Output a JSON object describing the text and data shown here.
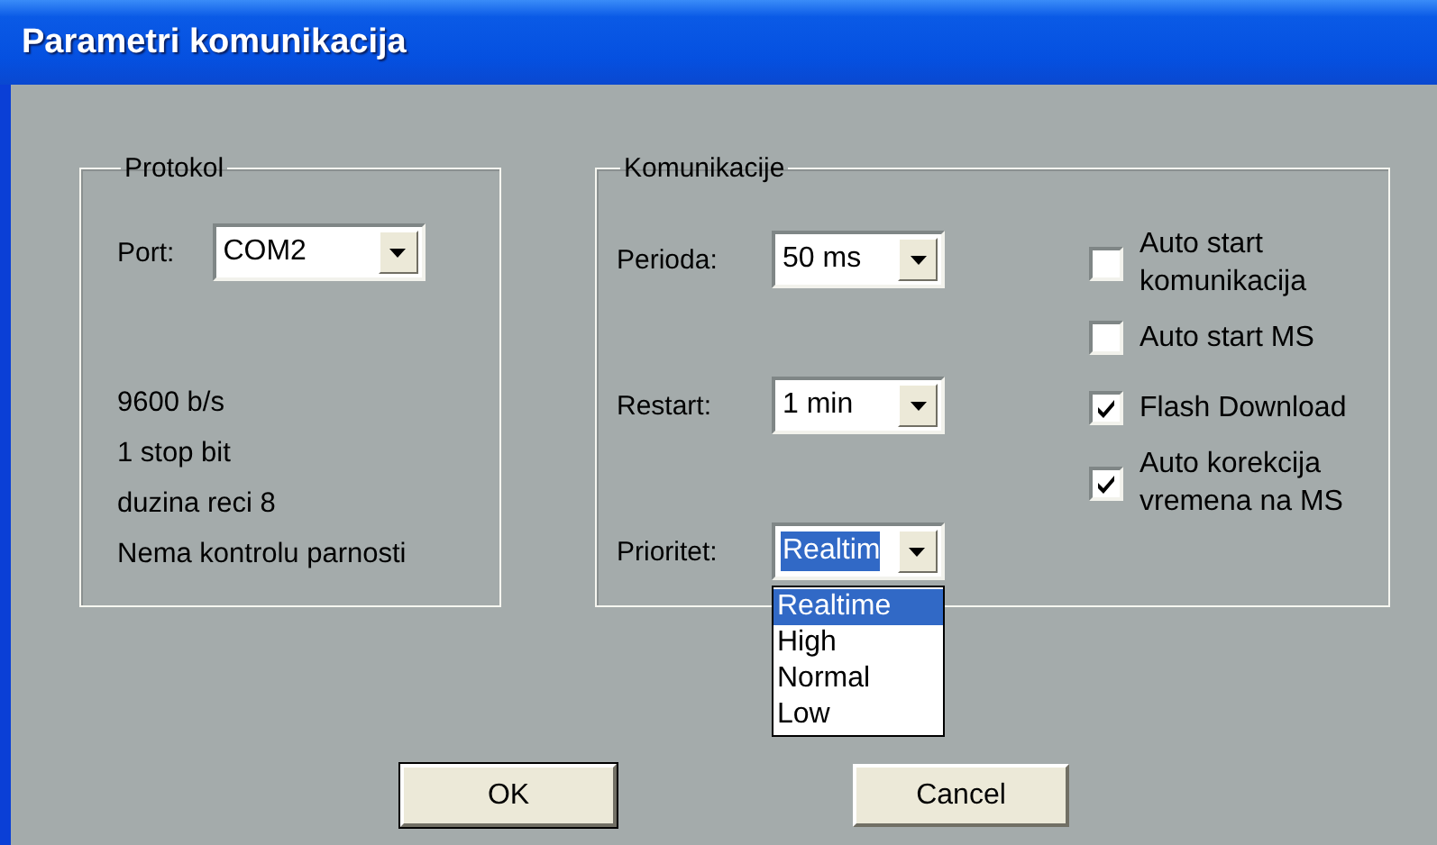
{
  "window": {
    "title": "Parametri komunikacija"
  },
  "protokol": {
    "title": "Protokol",
    "port": {
      "label": "Port:",
      "value": "COM2"
    },
    "info": [
      "9600 b/s",
      "1 stop bit",
      "duzina reci 8",
      "Nema kontrolu parnosti"
    ]
  },
  "komunikacije": {
    "title": "Komunikacije",
    "fields": [
      {
        "label": "Perioda:",
        "value": "50 ms",
        "focused": false
      },
      {
        "label": "Restart:",
        "value": "1 min",
        "focused": false
      },
      {
        "label": "Prioritet:",
        "value": "Realtim",
        "focused": true,
        "expanded": true,
        "options": [
          {
            "label": "Realtime",
            "selected": true
          },
          {
            "label": "High",
            "selected": false
          },
          {
            "label": "Normal",
            "selected": false
          },
          {
            "label": "Low",
            "selected": false
          }
        ]
      }
    ],
    "checkboxes": [
      {
        "label": "Auto start komunikacija",
        "checked": false
      },
      {
        "label": "Auto start MS",
        "checked": false
      },
      {
        "label": "Flash Download",
        "checked": true
      },
      {
        "label": "Auto korekcija vremena na MS",
        "checked": true
      }
    ]
  },
  "buttons": [
    {
      "label": "OK",
      "default": true
    },
    {
      "label": "Cancel",
      "default": false
    }
  ]
}
